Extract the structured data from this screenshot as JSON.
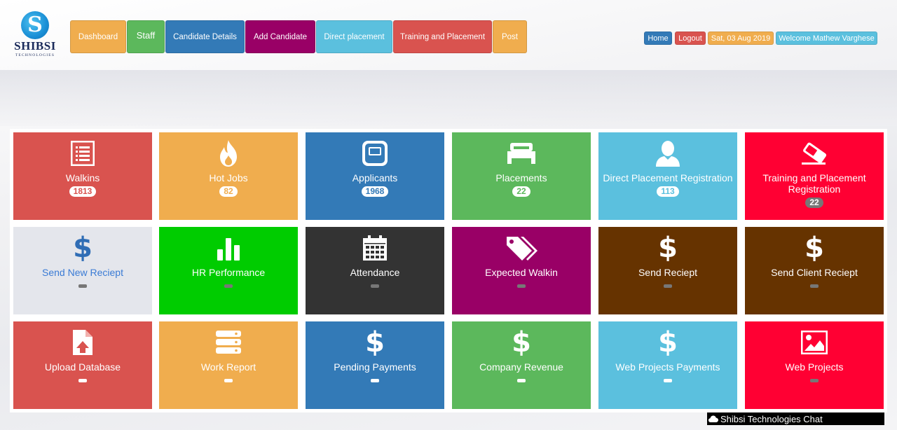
{
  "brand": {
    "name": "SHIBSI",
    "sub": "TECHNOLOGIES"
  },
  "nav": [
    {
      "label": "Dashboard",
      "color": "#f0ad4e"
    },
    {
      "label": "Staff",
      "color": "#5cb85c"
    },
    {
      "label": "Candidate Details",
      "color": "#337ab7"
    },
    {
      "label": "Add Candidate",
      "color": "#990066"
    },
    {
      "label": "Direct placement",
      "color": "#5bc0de"
    },
    {
      "label": "Training and Placement",
      "color": "#d9534f"
    },
    {
      "label": "Post",
      "color": "#f0ad4e"
    }
  ],
  "top_right": {
    "home": "Home",
    "logout": "Logout",
    "date": "Sat, 03 Aug 2019",
    "welcome": "Welcome Mathew Varghese"
  },
  "tiles": [
    {
      "label": "Walkins",
      "count": "1813",
      "icon": "list-icon",
      "color": "#d9534f"
    },
    {
      "label": "Hot Jobs",
      "count": "82",
      "icon": "fire-icon",
      "color": "#f0ad4e"
    },
    {
      "label": "Applicants",
      "count": "1968",
      "icon": "applicant-icon",
      "color": "#337ab7"
    },
    {
      "label": "Placements",
      "count": "22",
      "icon": "bed-icon",
      "color": "#5cb85c"
    },
    {
      "label": "Direct Placement Registration",
      "count": "113",
      "icon": "user-icon",
      "color": "#5bc0de"
    },
    {
      "label": "Training and Placement Registration",
      "count": "22",
      "icon": "eraser-icon",
      "color": "#ff0033"
    },
    {
      "label": "Send New Reciept",
      "count": "",
      "icon": "dollar-icon",
      "color": "#e4e6ec"
    },
    {
      "label": "HR Performance",
      "count": "",
      "icon": "bar-chart-icon",
      "color": "#00cc00"
    },
    {
      "label": "Attendance",
      "count": "",
      "icon": "calendar-icon",
      "color": "#333333"
    },
    {
      "label": "Expected Walkin",
      "count": "",
      "icon": "tags-icon",
      "color": "#990066"
    },
    {
      "label": "Send Reciept",
      "count": "",
      "icon": "dollar-icon",
      "color": "#663300"
    },
    {
      "label": "Send Client Reciept",
      "count": "",
      "icon": "dollar-icon",
      "color": "#663300"
    },
    {
      "label": "Upload Database",
      "count": "",
      "icon": "upload-file-icon",
      "color": "#d9534f"
    },
    {
      "label": "Work Report",
      "count": "",
      "icon": "server-icon",
      "color": "#f0ad4e"
    },
    {
      "label": "Pending Payments",
      "count": "",
      "icon": "dollar-icon",
      "color": "#337ab7"
    },
    {
      "label": "Company Revenue",
      "count": "",
      "icon": "dollar-icon",
      "color": "#5cb85c"
    },
    {
      "label": "Web Projects Payments",
      "count": "",
      "icon": "dollar-icon",
      "color": "#5bc0de"
    },
    {
      "label": "Web Projects",
      "count": "",
      "icon": "picture-icon",
      "color": "#ff0033"
    }
  ],
  "chat": {
    "label": "Shibsi Technologies Chat"
  }
}
